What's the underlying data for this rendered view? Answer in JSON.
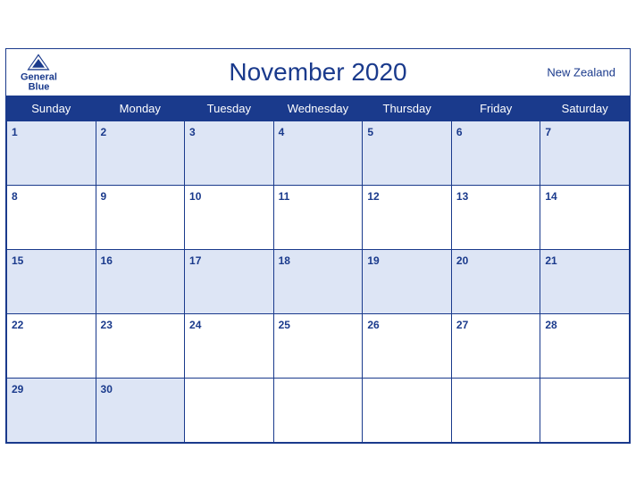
{
  "header": {
    "month_title": "November 2020",
    "country": "New Zealand",
    "logo_general": "General",
    "logo_blue": "Blue"
  },
  "weekdays": [
    "Sunday",
    "Monday",
    "Tuesday",
    "Wednesday",
    "Thursday",
    "Friday",
    "Saturday"
  ],
  "weeks": [
    [
      {
        "day": 1,
        "empty": false
      },
      {
        "day": 2,
        "empty": false
      },
      {
        "day": 3,
        "empty": false
      },
      {
        "day": 4,
        "empty": false
      },
      {
        "day": 5,
        "empty": false
      },
      {
        "day": 6,
        "empty": false
      },
      {
        "day": 7,
        "empty": false
      }
    ],
    [
      {
        "day": 8,
        "empty": false
      },
      {
        "day": 9,
        "empty": false
      },
      {
        "day": 10,
        "empty": false
      },
      {
        "day": 11,
        "empty": false
      },
      {
        "day": 12,
        "empty": false
      },
      {
        "day": 13,
        "empty": false
      },
      {
        "day": 14,
        "empty": false
      }
    ],
    [
      {
        "day": 15,
        "empty": false
      },
      {
        "day": 16,
        "empty": false
      },
      {
        "day": 17,
        "empty": false
      },
      {
        "day": 18,
        "empty": false
      },
      {
        "day": 19,
        "empty": false
      },
      {
        "day": 20,
        "empty": false
      },
      {
        "day": 21,
        "empty": false
      }
    ],
    [
      {
        "day": 22,
        "empty": false
      },
      {
        "day": 23,
        "empty": false
      },
      {
        "day": 24,
        "empty": false
      },
      {
        "day": 25,
        "empty": false
      },
      {
        "day": 26,
        "empty": false
      },
      {
        "day": 27,
        "empty": false
      },
      {
        "day": 28,
        "empty": false
      }
    ],
    [
      {
        "day": 29,
        "empty": false
      },
      {
        "day": 30,
        "empty": false
      },
      {
        "day": null,
        "empty": true
      },
      {
        "day": null,
        "empty": true
      },
      {
        "day": null,
        "empty": true
      },
      {
        "day": null,
        "empty": true
      },
      {
        "day": null,
        "empty": true
      }
    ]
  ]
}
